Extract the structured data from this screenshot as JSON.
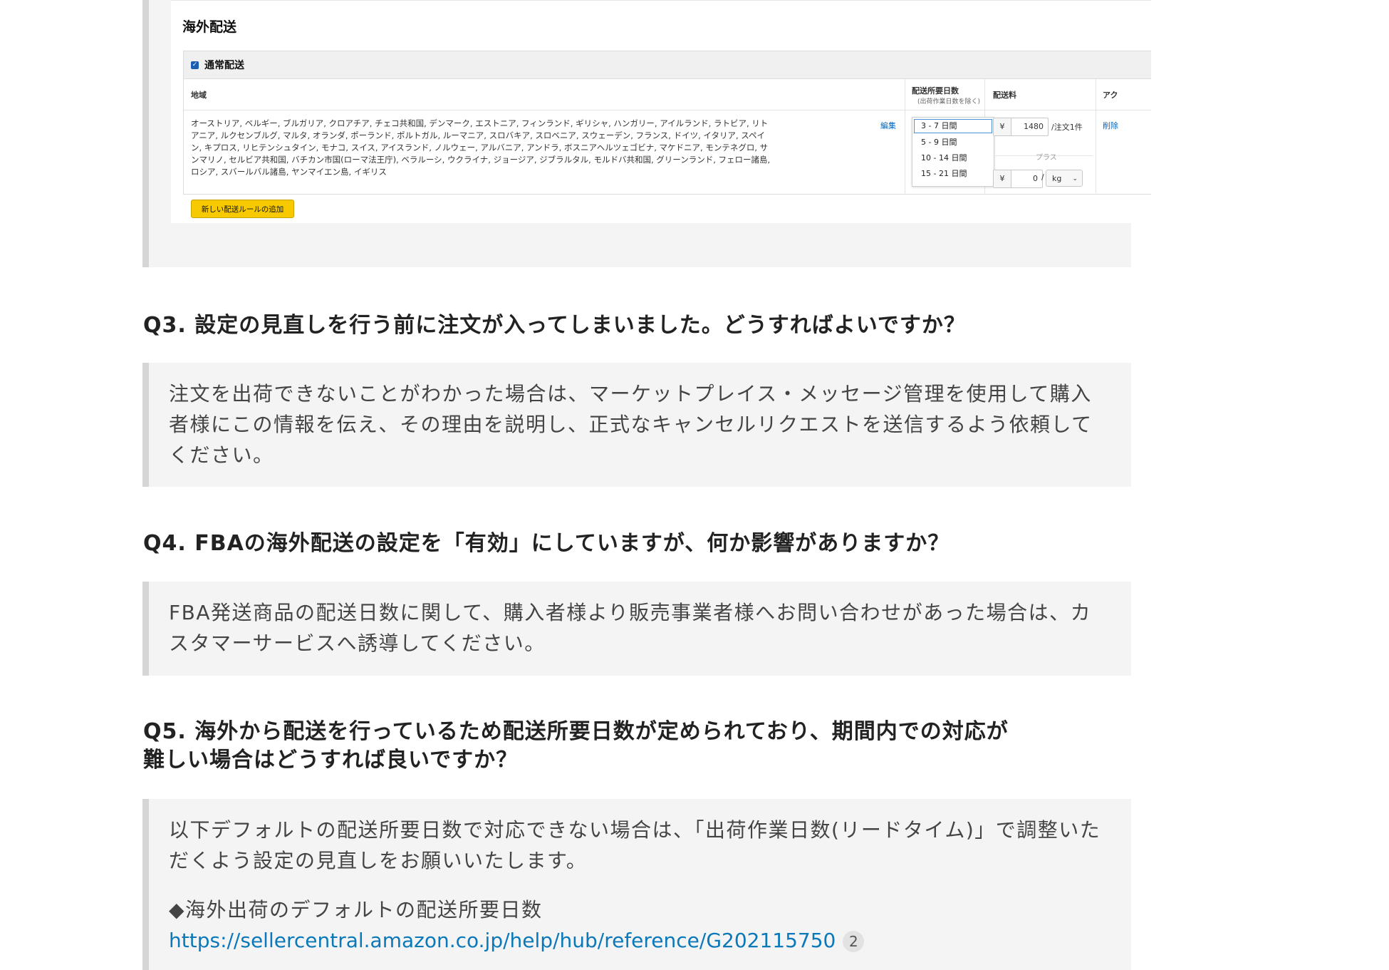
{
  "screenshot": {
    "title": "海外配送",
    "section_label": "通常配送",
    "columns": {
      "region": "地域",
      "days": "配送所要日数",
      "days_sub": "(出荷作業日数を除く)",
      "fee": "配送料",
      "action": "アク"
    },
    "regions_text": "オーストリア, ベルギー, ブルガリア, クロアチア, チェコ共和国, デンマーク, エストニア, フィンランド, ギリシャ, ハンガリー, アイルランド, ラトビア, リトアニア, ルクセンブルグ, マルタ, オランダ, ポーランド, ポルトガル, ルーマニア, スロバキア, スロベニア, スウェーデン, フランス, ドイツ, イタリア, スペイン, キプロス, リヒテンシュタイン, モナコ, スイス, アイスランド, ノルウェー, アルバニア, アンドラ, ボスニアヘルツェゴビナ, マケドニア, モンテネグロ, サンマリノ, セルビア共和国, バチカン市国(ローマ法王庁), ベラルーシ, ウクライナ, ジョージア, ジブラルタル, モルドバ共和国, グリーンランド, フェロー諸島, ロシア, スバールバル諸島, ヤンマイエン島, イギリス",
    "edit_label": "編集",
    "day_options": [
      "3 - 7 日間",
      "5 - 9 日間",
      "10 - 14 日間",
      "15 - 21 日間"
    ],
    "selected_day": "3 - 7 日間",
    "fee_currency": "¥",
    "fee_per_order": "1480",
    "fee_per_order_unit": "/注文1件",
    "plus_label": "プラス",
    "fee_per_weight": "0",
    "fee_per_weight_sep": "/",
    "weight_unit": "kg",
    "delete_label": "削除",
    "add_rule_label": "新しい配送ルールの追加"
  },
  "faq": [
    {
      "question": "Q3.  設定の見直しを行う前に注文が入ってしまいました。どうすればよいですか？",
      "answer": "注文を出荷できないことがわかった場合は、マーケットプレイス・メッセージ管理を使用して購入者様にこの情報を伝え、その理由を説明し、正式なキャンセルリクエストを送信するよう依頼してください。"
    },
    {
      "question": "Q4.  FBAの海外配送の設定を「有効」にしていますが、何か影響がありますか？",
      "answer": "FBA発送商品の配送日数に関して、購入者様より販売事業者様へお問い合わせがあった場合は、カスタマーサービスへ誘導してください。"
    },
    {
      "question_line1": "Q5.  海外から配送を行っているため配送所要日数が定められており、期間内での対応が",
      "question_line2": "難しい場合はどうすれば良いですか？",
      "answer": "以下デフォルトの配送所要日数で対応できない場合は、「出荷作業日数(リードタイム)」で調整いただくよう設定の見直しをお願いいたします。",
      "answer_heading": "◆海外出荷のデフォルトの配送所要日数",
      "link": "https://sellercentral.amazon.co.jp/help/hub/reference/G202115750",
      "link_badge": "2"
    }
  ]
}
